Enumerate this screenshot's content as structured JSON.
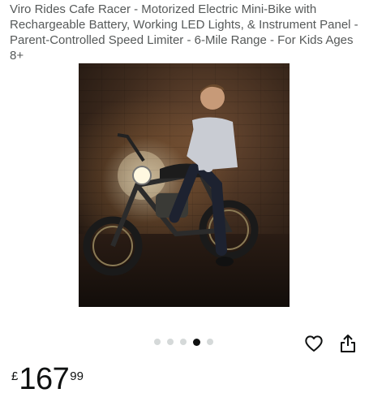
{
  "product": {
    "title": "Viro Rides Cafe Racer - Motorized Electric Mini-Bike with Rechargeable Battery, Working LED Lights, & Instrument Panel - Parent-Controlled Speed Limiter - 6-Mile Range - For Kids Ages 8+",
    "image": "product-photo",
    "carousel": {
      "count": 5,
      "active_index": 3
    }
  },
  "price": {
    "currency_symbol": "£",
    "whole": "167",
    "fraction": "99"
  },
  "actions": {
    "wishlist_icon": "heart-icon",
    "share_icon": "share-icon"
  }
}
